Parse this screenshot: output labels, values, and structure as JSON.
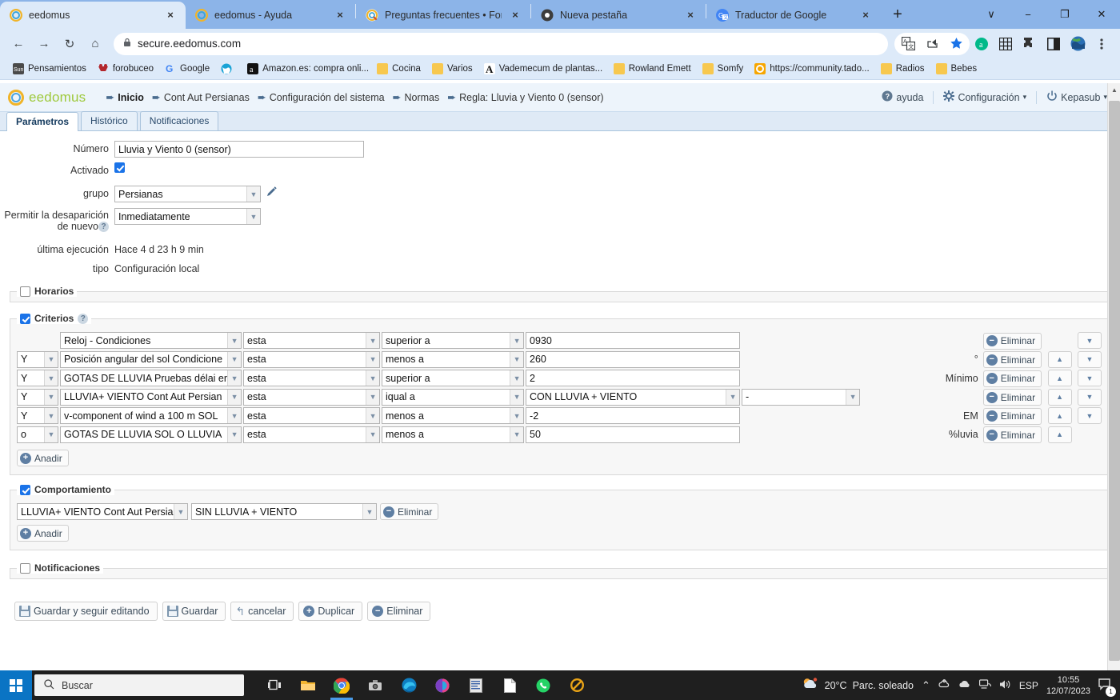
{
  "browser": {
    "tabs": [
      {
        "title": "eedomus",
        "favicon": "eedomus-icon",
        "active": true
      },
      {
        "title": "eedomus - Ayuda",
        "favicon": "eedomus-icon",
        "active": false
      },
      {
        "title": "Preguntas frecuentes • Foro eedo",
        "favicon": "forum-icon",
        "active": false
      },
      {
        "title": "Nueva pestaña",
        "favicon": "chrome-icon",
        "active": false
      },
      {
        "title": "Traductor de Google",
        "favicon": "google-translate-icon",
        "active": false
      }
    ],
    "new_tab_label": "+",
    "tab_close_label": "×",
    "window_controls": {
      "list": "∨",
      "minimize": "−",
      "maximize": "❐",
      "close": "✕"
    },
    "nav": {
      "back": "←",
      "forward": "→",
      "reload": "↻",
      "home": "⌂"
    },
    "address": {
      "lock": "🔒",
      "url": "secure.eedomus.com"
    },
    "toolbar_icons": [
      "translate-icon",
      "share-icon",
      "bookmark-star-icon",
      "adblock-icon",
      "grid-extension-icon",
      "puzzle-extension-icon",
      "sidepanel-icon",
      "profile-avatar-icon",
      "chrome-menu-icon"
    ],
    "bookmarks": [
      {
        "label": "Pensamientos",
        "icon": "sun-icon"
      },
      {
        "label": "forobuceo",
        "icon": "forobuceo-icon"
      },
      {
        "label": "Google",
        "icon": "google-icon"
      },
      {
        "label": "",
        "icon": "globe-icon"
      },
      {
        "label": "Amazon.es: compra onli...",
        "icon": "amazon-icon"
      },
      {
        "label": "Cocina",
        "icon": "folder-icon"
      },
      {
        "label": "Varios",
        "icon": "folder-icon"
      },
      {
        "label": "Vademecum de plantas...",
        "icon": "letter-a-icon"
      },
      {
        "label": "Rowland Emett",
        "icon": "folder-icon"
      },
      {
        "label": "Somfy",
        "icon": "folder-icon"
      },
      {
        "label": "https://community.tado...",
        "icon": "tado-icon"
      },
      {
        "label": "Radios",
        "icon": "folder-icon"
      },
      {
        "label": "Bebes",
        "icon": "folder-icon"
      }
    ]
  },
  "app": {
    "logo_text": "eedomus",
    "breadcrumbs": [
      {
        "label": "Inicio"
      },
      {
        "label": "Cont Aut Persianas"
      },
      {
        "label": "Configuración del sistema"
      },
      {
        "label": "Normas"
      },
      {
        "label": "Regla: Lluvia y Viento 0 (sensor)"
      }
    ],
    "header_right": [
      {
        "label": "ayuda",
        "icon": "help-icon"
      },
      {
        "label": "Configuración",
        "icon": "gear-icon",
        "caret": "▾"
      },
      {
        "label": "Kepasub",
        "icon": "power-icon",
        "caret": "▾"
      }
    ],
    "tabs": [
      {
        "label": "Parámetros",
        "active": true
      },
      {
        "label": "Histórico",
        "active": false
      },
      {
        "label": "Notificaciones",
        "active": false
      }
    ],
    "fields": {
      "numero_label": "Número",
      "numero_value": "Lluvia y Viento 0 (sensor)",
      "activado_label": "Activado",
      "activado_checked": true,
      "grupo_label": "grupo",
      "grupo_value": "Persianas",
      "desaparicion_label": "Permitir la desaparición de nuevo",
      "desaparicion_value": "Inmediatamente",
      "ultima_label": "última ejecución",
      "ultima_value": "Hace 4 d 23 h 9 min",
      "tipo_label": "tipo",
      "tipo_value": "Configuración local"
    },
    "sections": {
      "horarios": {
        "label": "Horarios",
        "checked": false
      },
      "criterios": {
        "label": "Criterios",
        "checked": true
      },
      "comportamiento": {
        "label": "Comportamiento",
        "checked": true
      },
      "notificaciones": {
        "label": "Notificaciones",
        "checked": false
      }
    },
    "criteria_rows": [
      {
        "logic": "",
        "source": "Reloj - Condiciones",
        "state": "esta",
        "comparator": "superior a",
        "value": "0930",
        "value2": "",
        "unit": "",
        "has_up": false,
        "has_down": true
      },
      {
        "logic": "Y",
        "source": "Posición angular del sol Condicione",
        "state": "esta",
        "comparator": "menos a",
        "value": "260",
        "value2": "",
        "unit": "°",
        "has_up": true,
        "has_down": true
      },
      {
        "logic": "Y",
        "source": "GOTAS DE LLUVIA Pruebas délai er",
        "state": "esta",
        "comparator": "superior a",
        "value": "2",
        "value2": "",
        "unit": "Mínimo",
        "has_up": true,
        "has_down": true
      },
      {
        "logic": "Y",
        "source": "LLUVIA+ VIENTO Cont Aut Persian",
        "state": "esta",
        "comparator": "iqual a",
        "value": "CON LLUVIA + VIENTO",
        "value2": "-",
        "unit": "",
        "has_up": true,
        "has_down": true
      },
      {
        "logic": "Y",
        "source": "v-component of wind a 100 m SOL",
        "state": "esta",
        "comparator": "menos a",
        "value": "-2",
        "value2": "",
        "unit": "EM",
        "has_up": true,
        "has_down": true
      },
      {
        "logic": "o",
        "source": "GOTAS DE LLUVIA SOL O LLUVIA",
        "state": "esta",
        "comparator": "menos a",
        "value": "50",
        "value2": "",
        "unit": "%luvia",
        "has_up": true,
        "has_down": false
      }
    ],
    "behavior_rows": [
      {
        "target": "LLUVIA+ VIENTO Cont Aut Persian",
        "action": "SIN LLUVIA + VIENTO"
      }
    ],
    "buttons": {
      "add": "Anadir",
      "remove": "Eliminar",
      "save_continue": "Guardar y seguir editando",
      "save": "Guardar",
      "cancel": "cancelar",
      "duplicate": "Duplicar",
      "delete": "Eliminar",
      "move_up": "▲",
      "move_down": "▼"
    }
  },
  "taskbar": {
    "start_icon": "windows-start-icon",
    "search_placeholder": "Buscar",
    "apps": [
      "task-view-icon",
      "file-explorer-icon",
      "chrome-icon",
      "camera-app-icon",
      "edge-icon",
      "powerbi-icon",
      "word-icon",
      "notepad-icon",
      "whatsapp-icon",
      "eedomus-app-icon"
    ],
    "weather_temp": "20°C",
    "weather_desc": "Parc. soleado",
    "tray_icons": [
      "chevron-up-icon",
      "onedrive-sync-icon",
      "cloud-icon",
      "network-icon",
      "volume-icon"
    ],
    "language": "ESP",
    "time": "10:55",
    "date": "12/07/2023",
    "notification_count": "1"
  }
}
